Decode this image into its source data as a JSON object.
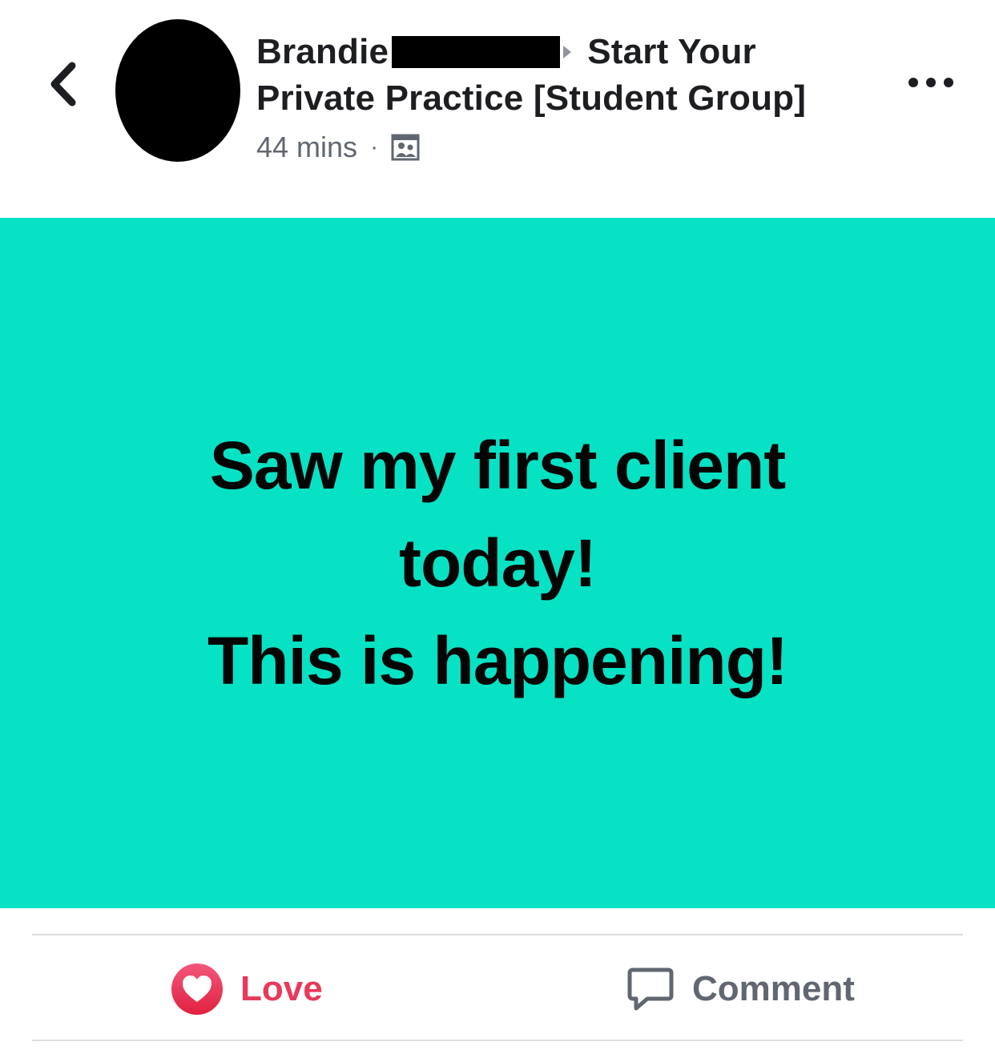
{
  "header": {
    "author_name": "Brandie",
    "group_name": "Start Your Private Practice [Student Group]",
    "group_name_part1": "Start Your",
    "group_name_part2": "Private Practice [Student Group]",
    "timestamp": "44 mins",
    "separator": "·",
    "privacy": "group-members-icon"
  },
  "post": {
    "lines": [
      "Saw my first client",
      "today!",
      "This is happening!"
    ],
    "background_color": "#06e2c3",
    "text_color": "#050505"
  },
  "actions": {
    "love_label": "Love",
    "comment_label": "Comment",
    "love_color": "#e8395a"
  },
  "icons": {
    "back": "chevron-left-icon",
    "more": "more-dots-icon",
    "love": "heart-icon",
    "comment": "speech-bubble-icon"
  }
}
